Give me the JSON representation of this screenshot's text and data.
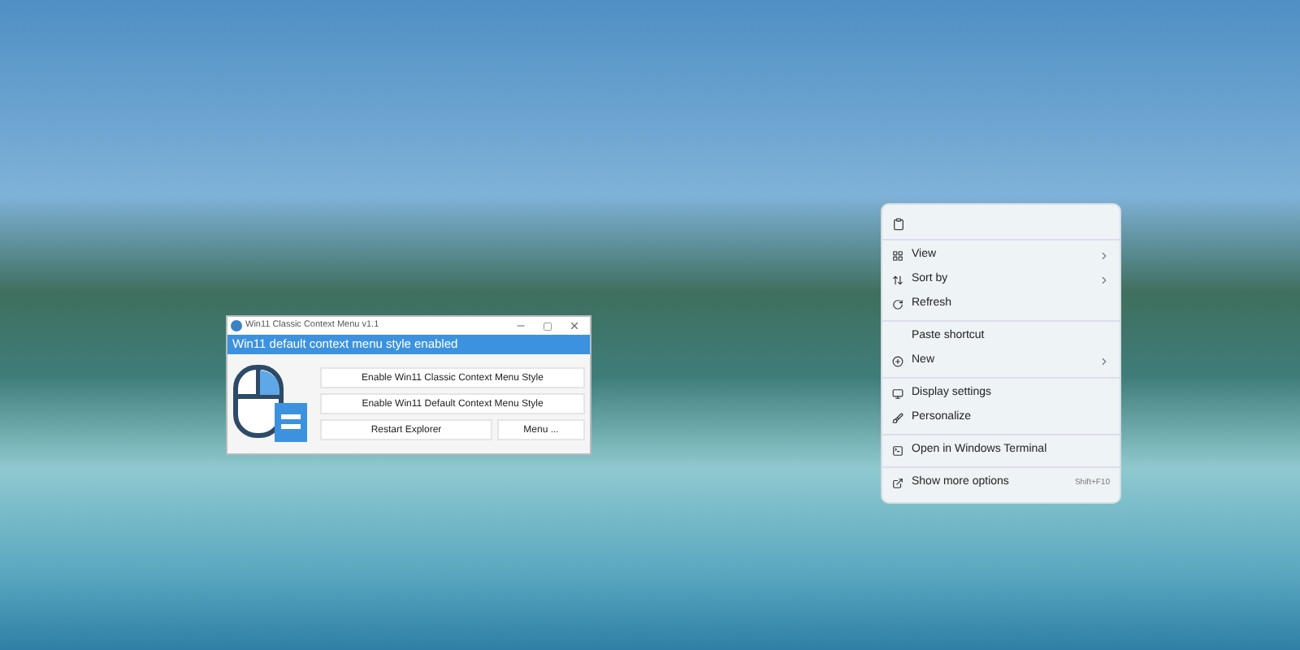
{
  "app_window": {
    "title": "Win11 Classic Context Menu v1.1",
    "status": "Win11 default context menu style enabled",
    "buttons": [
      {
        "label": "Enable Win11 Classic Context Menu Style"
      },
      {
        "label": "Enable Win11 Default Context Menu Style"
      },
      {
        "label": "Restart Explorer"
      },
      {
        "label": "Menu ..."
      }
    ]
  },
  "context_menu": {
    "groups": [
      [
        {
          "label": "View",
          "submenu": true
        },
        {
          "label": "Sort by",
          "submenu": true
        },
        {
          "label": "Refresh",
          "submenu": false
        }
      ],
      [
        {
          "label": "Paste shortcut",
          "submenu": false
        },
        {
          "label": "New",
          "submenu": true
        }
      ],
      [
        {
          "label": "Display settings",
          "submenu": false
        },
        {
          "label": "Personalize",
          "submenu": false
        }
      ],
      [
        {
          "label": "Open in Windows Terminal",
          "submenu": false
        }
      ],
      [
        {
          "label": "Show more options",
          "submenu": false,
          "shortcut": "Shift+F10"
        }
      ]
    ]
  }
}
